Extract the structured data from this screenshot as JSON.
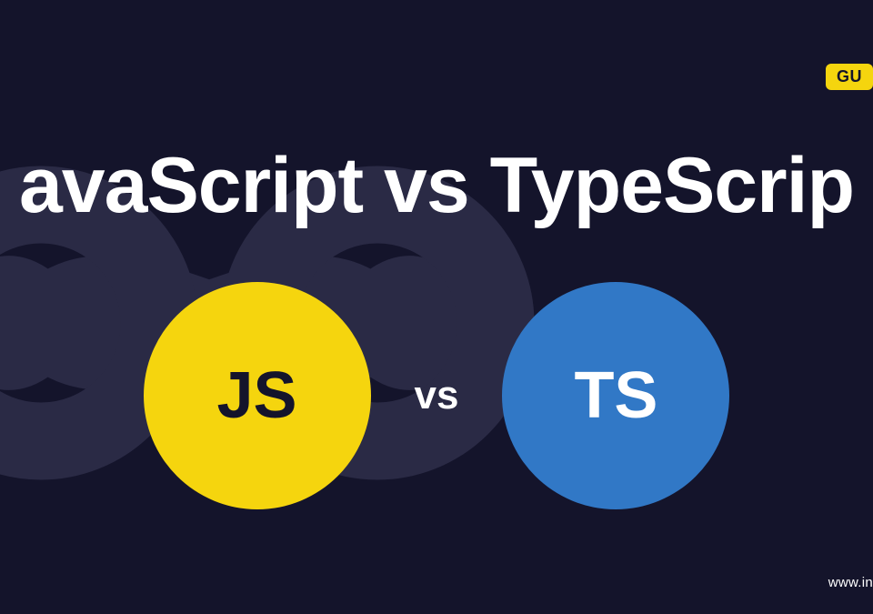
{
  "badge": {
    "text": "GU"
  },
  "title": "avaScript vs TypeScrip",
  "circles": {
    "left": {
      "label": "JS"
    },
    "right": {
      "label": "TS"
    },
    "vs": "vs"
  },
  "footer": {
    "url": "www.in"
  },
  "colors": {
    "background": "#14142b",
    "yellow": "#f5d50e",
    "blue": "#3178c6",
    "infinity": "#2a2a45"
  }
}
